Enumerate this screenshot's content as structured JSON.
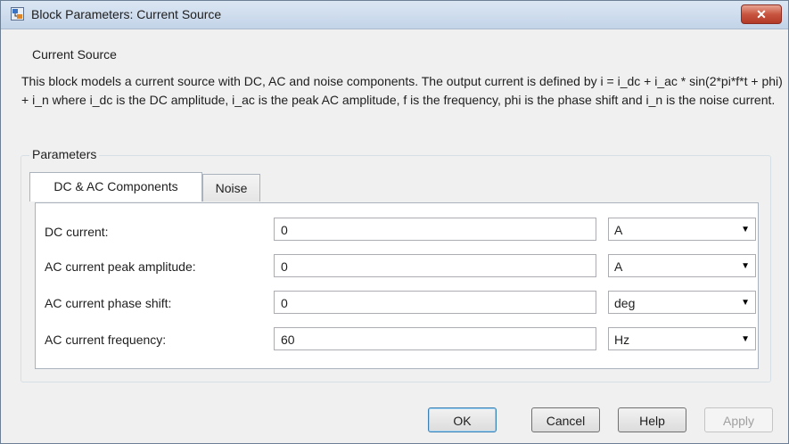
{
  "window": {
    "title": "Block Parameters: Current Source",
    "close_glyph": "✕"
  },
  "block_group": {
    "label": "Current Source",
    "description": "This block models a current source with DC, AC and noise components. The output current is defined by i = i_dc + i_ac * sin(2*pi*f*t + phi) + i_n where i_dc is the DC amplitude, i_ac is the peak AC amplitude, f is the frequency, phi is the phase shift and i_n is the noise current."
  },
  "parameters": {
    "label": "Parameters",
    "tabs": [
      {
        "label": "DC & AC Components",
        "active": true
      },
      {
        "label": "Noise",
        "active": false
      }
    ],
    "rows": [
      {
        "label": "DC current:",
        "value": "0",
        "unit": "A"
      },
      {
        "label": "AC current peak amplitude:",
        "value": "0",
        "unit": "A"
      },
      {
        "label": "AC current phase shift:",
        "value": "0",
        "unit": "deg"
      },
      {
        "label": "AC current frequency:",
        "value": "60",
        "unit": "Hz"
      }
    ]
  },
  "buttons": {
    "ok": "OK",
    "cancel": "Cancel",
    "help": "Help",
    "apply": "Apply"
  },
  "icons": {
    "app": "simulink-block-icon",
    "close": "close-icon",
    "dropdown": "chevron-down-icon"
  },
  "colors": {
    "titlebar": "#c3d4e8",
    "close_button": "#c8553f",
    "default_button_border": "#3c7fb1"
  }
}
